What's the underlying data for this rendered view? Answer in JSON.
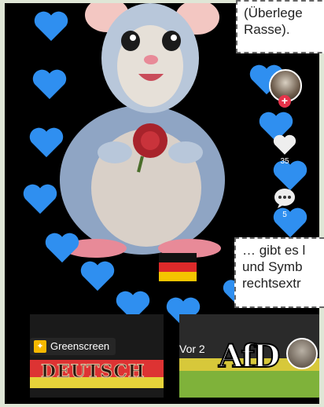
{
  "overlays": {
    "top_text_line1": "(Überlege",
    "top_text_line2": "Rasse).",
    "bottom_text_line1": "… gibt es l",
    "bottom_text_line2": "und Symb",
    "bottom_text_line3": "rechtsextr"
  },
  "side": {
    "like_count": "35",
    "comment_count": "5"
  },
  "thumbs": {
    "badge_label": "Greenscreen",
    "thumb1_text": "DEUTSCH",
    "thumb2_text": "AfD",
    "thumb2_prefix": "Vor 2"
  },
  "colors": {
    "heart": "#2f8ff0",
    "accent_red": "#e8334a"
  },
  "icons": {
    "heart": "heart-icon",
    "comment": "comment-icon",
    "flag": "germany-flag-icon"
  }
}
